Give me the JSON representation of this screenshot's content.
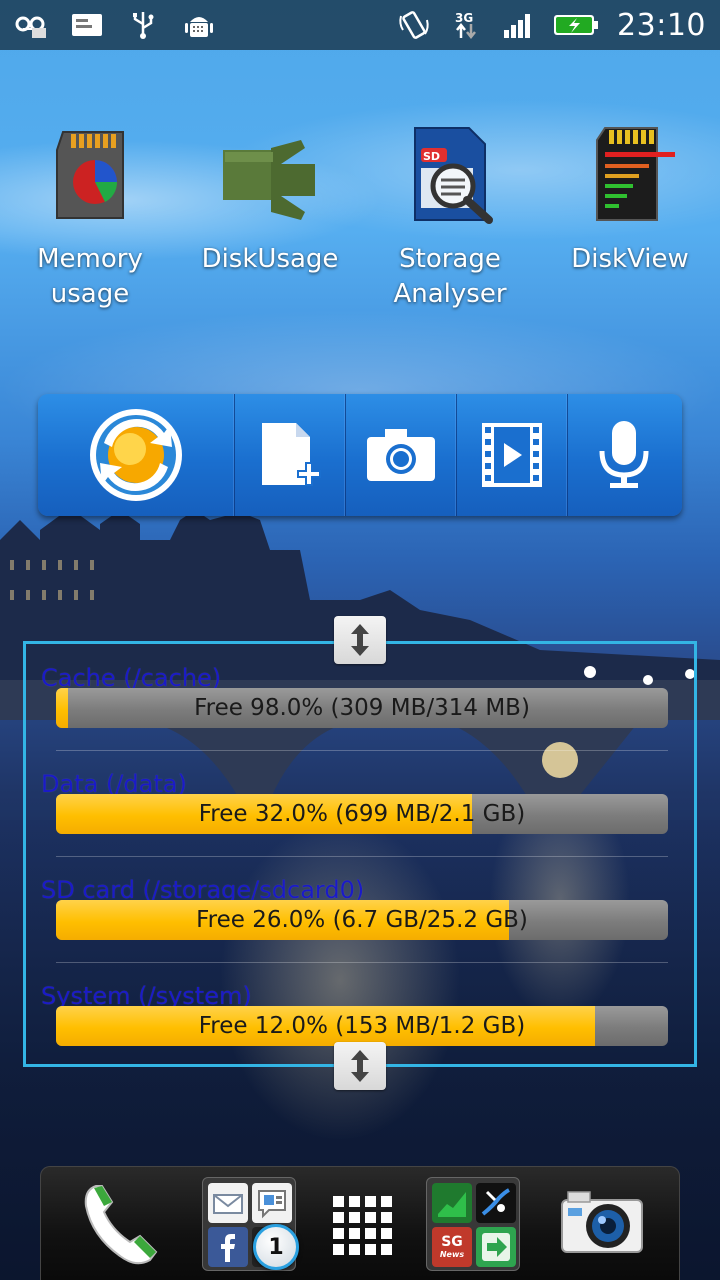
{
  "status_bar": {
    "time": "23:10",
    "network": "3G",
    "left_icons": [
      "voicemail-icon",
      "email-icon",
      "usb-icon",
      "android-debug-icon"
    ],
    "right_icons": [
      "rotate-icon",
      "3g-data-icon",
      "signal-icon",
      "battery-charging-icon"
    ]
  },
  "apps": [
    {
      "label": "Memory usage",
      "icon": "memory-usage-icon"
    },
    {
      "label": "DiskUsage",
      "icon": "disk-usage-icon"
    },
    {
      "label": "Storage Analyser",
      "icon": "storage-analyser-icon"
    },
    {
      "label": "DiskView",
      "icon": "disk-view-icon"
    }
  ],
  "quick_bar": {
    "actions": [
      "sync-icon",
      "new-document-icon",
      "camera-icon",
      "video-icon",
      "microphone-icon"
    ]
  },
  "storage_widget": {
    "items": [
      {
        "title": "Cache (/cache)",
        "text": "Free 98.0% (309 MB/314 MB)",
        "used_fraction": 0.02
      },
      {
        "title": "Data (/data)",
        "text": "Free 32.0% (699 MB/2.1 GB)",
        "used_fraction": 0.68
      },
      {
        "title": "SD card (/storage/sdcard0)",
        "text": "Free 26.0% (6.7 GB/25.2 GB)",
        "used_fraction": 0.74
      },
      {
        "title": "System (/system)",
        "text": "Free 12.0% (153 MB/1.2 GB)",
        "used_fraction": 0.88
      }
    ]
  },
  "dock": {
    "items": [
      "phone-icon",
      "folder-social",
      "app-drawer-icon",
      "folder-apps",
      "camera-app-icon"
    ],
    "folder_social": {
      "apps": [
        "email-icon",
        "messaging-icon",
        "facebook-icon",
        "camera-roll-icon"
      ],
      "badge": "1"
    },
    "folder_apps": {
      "apps": [
        "stocks-icon",
        "navigation-icon",
        "sg-news-icon",
        "share-arrow-icon"
      ],
      "sg_label": "SG",
      "news_label": "News"
    }
  }
}
